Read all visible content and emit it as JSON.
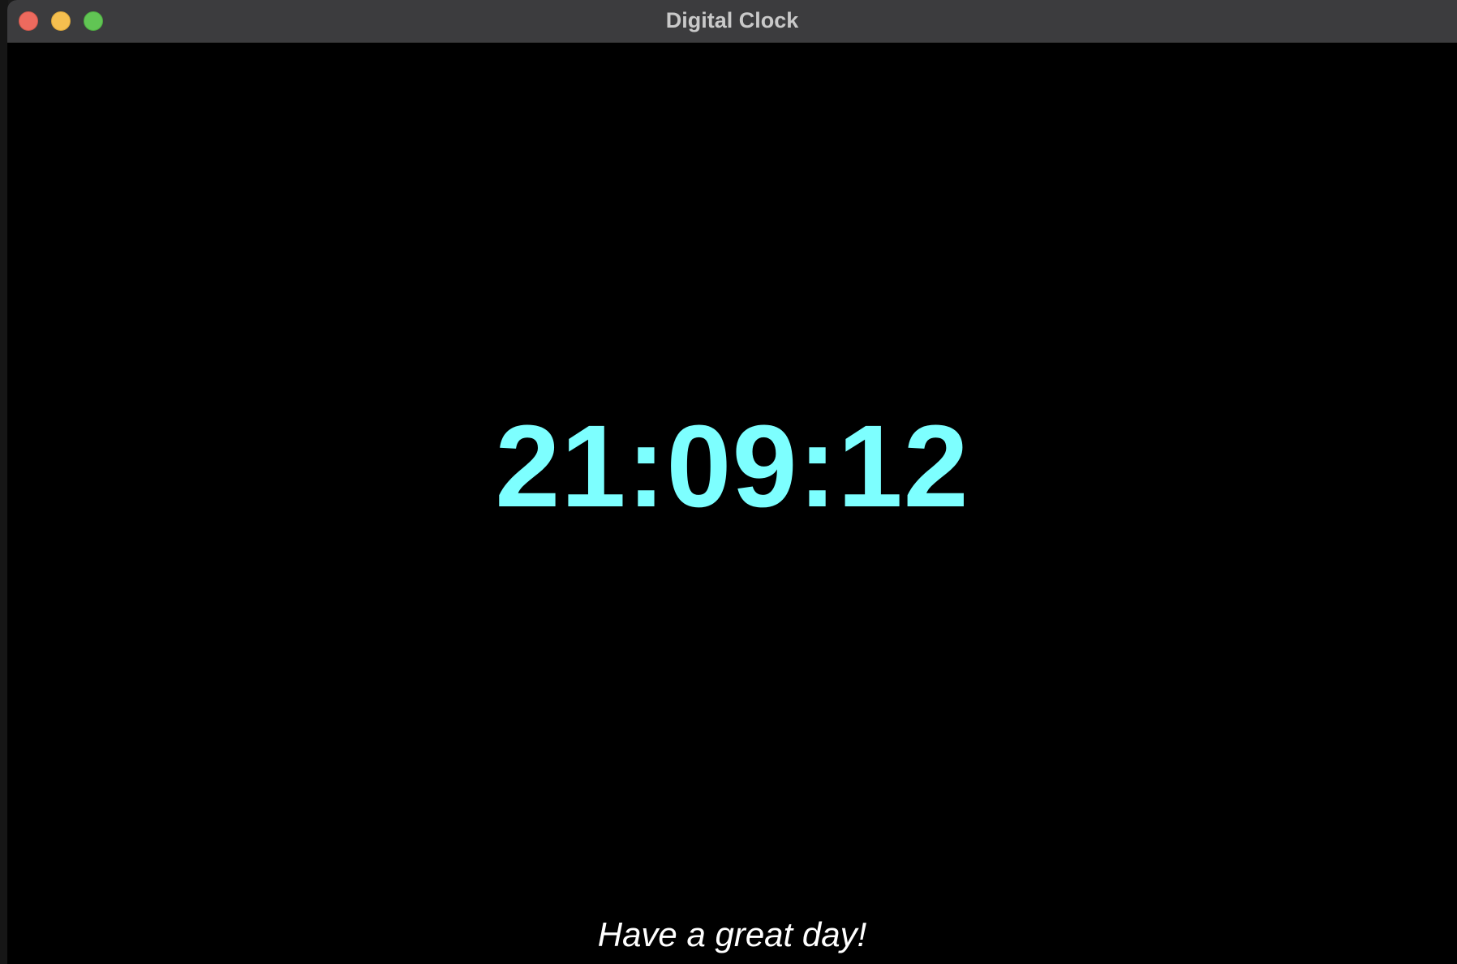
{
  "window": {
    "title": "Digital Clock"
  },
  "clock": {
    "time": "21:09:12",
    "color": "#7dffff"
  },
  "greeting": {
    "text": "Have a great day!"
  },
  "traffic_lights": {
    "close_color": "#ed6a5e",
    "minimize_color": "#f5bf4f",
    "zoom_color": "#61c554"
  }
}
